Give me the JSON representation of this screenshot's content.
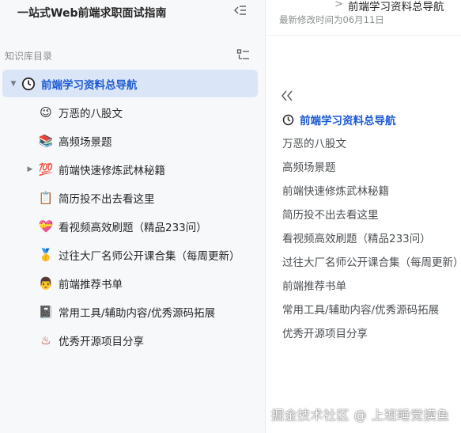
{
  "sidebar": {
    "title": "一站式Web前端求职面试指南",
    "toc_label": "知识库目录",
    "items": [
      {
        "label": "前端学习资料总导航",
        "icon": "clock-icon",
        "glyph": "",
        "caret": "▼"
      },
      {
        "label": "万恶的八股文",
        "icon": "smile-face-icon",
        "glyph": "😉",
        "caret": ""
      },
      {
        "label": "高频场景题",
        "icon": "book-icon",
        "glyph": "📚",
        "caret": ""
      },
      {
        "label": "前端快速修炼武林秘籍",
        "icon": "hundred-points-icon",
        "glyph": "💯",
        "caret": "▶"
      },
      {
        "label": "简历投不出去看这里",
        "icon": "clipboard-icon",
        "glyph": "📋",
        "caret": ""
      },
      {
        "label": "看视频高效刷题（精品233问）",
        "icon": "heart-icon",
        "glyph": "💝",
        "caret": ""
      },
      {
        "label": "过往大厂名师公开课合集（每周更新）",
        "icon": "medal-icon",
        "glyph": "🥇",
        "caret": ""
      },
      {
        "label": "前端推荐书单",
        "icon": "reader-icon",
        "glyph": "👨",
        "caret": ""
      },
      {
        "label": "常用工具/辅助内容/优秀源码拓展",
        "icon": "notebook-icon",
        "glyph": "📓",
        "caret": ""
      },
      {
        "label": "优秀开源项目分享",
        "icon": "hot-springs-icon",
        "glyph": "♨",
        "caret": ""
      }
    ]
  },
  "main": {
    "breadcrumb_sep": ">",
    "breadcrumb_title": "前端学习资料总导航",
    "modified": "最新修改时间为06月11日",
    "toc_heading": "前端学习资料总导航",
    "toc_items": [
      "万恶的八股文",
      "高频场景题",
      "前端快速修炼武林秘籍",
      "简历投不出去看这里",
      "看视频高效刷题（精品233问）",
      "过往大厂名师公开课合集（每周更新）",
      "前端推荐书单",
      "常用工具/辅助内容/优秀源码拓展",
      "优秀开源项目分享"
    ]
  },
  "watermark": "掘金技术社区 @ 上班睡觉摸鱼",
  "colors": {
    "accent": "#1d5bd4",
    "active_bg": "#dbe5f8",
    "sidebar_bg": "#f7f8fa",
    "muted": "#8a8f8d"
  }
}
